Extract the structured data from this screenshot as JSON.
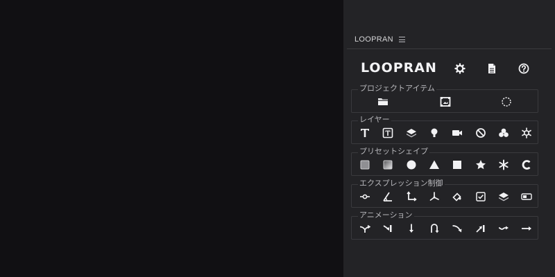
{
  "panel": {
    "title": "LOOPRAN",
    "logo": "LOOPRAN"
  },
  "sections": {
    "project": {
      "title": "プロジェクトアイテム"
    },
    "layer": {
      "title": "レイヤー"
    },
    "shape": {
      "title": "プリセットシェイプ"
    },
    "expression": {
      "title": "エクスプレッション制御"
    },
    "animation": {
      "title": "アニメーション"
    }
  },
  "colors": {
    "canvas": "#111013",
    "panel": "#232326",
    "icon": "#f2f2f4",
    "border": "#3a3a3e"
  }
}
